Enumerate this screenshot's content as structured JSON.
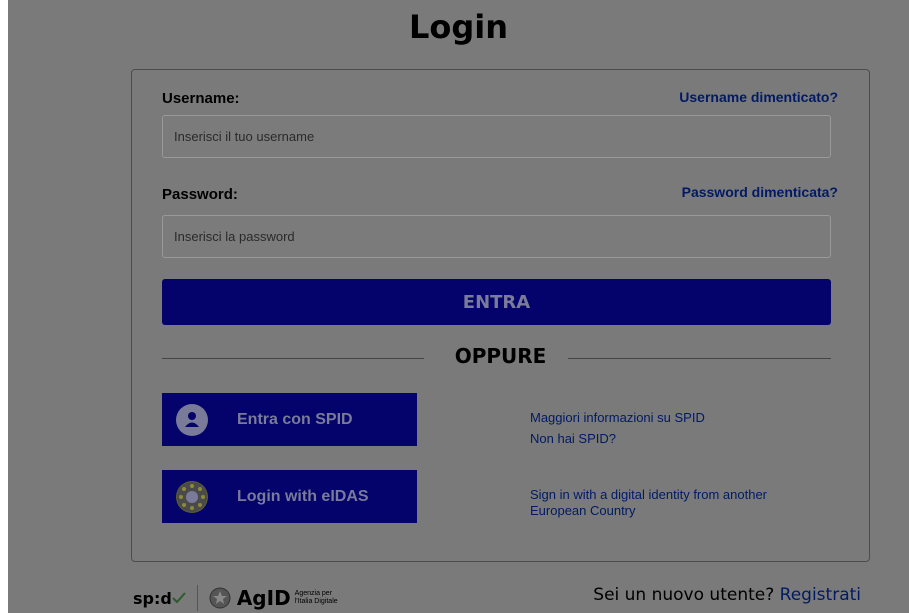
{
  "page": {
    "title": "Login"
  },
  "form": {
    "username_label": "Username:",
    "username_forgot": "Username dimenticato?",
    "username_placeholder": "Inserisci il tuo username",
    "password_label": "Password:",
    "password_forgot": "Password dimenticata?",
    "password_placeholder": "Inserisci la password",
    "submit_label": "ENTRA",
    "separator_label": "OPPURE"
  },
  "identity": {
    "spid_button_label": "Entra con SPID",
    "spid_info_link": "Maggiori informazioni su SPID",
    "spid_missing_link": "Non hai SPID?",
    "eidas_button_label": "Login with eIDAS",
    "eidas_info_line1": "Sign in with a digital identity from another",
    "eidas_info_line2": "European Country"
  },
  "footer": {
    "spid_logo_text": "sp:d",
    "agid_logo_text": "AgID",
    "agid_sub_line1": "Agenzia per",
    "agid_sub_line2": "l'Italia Digitale",
    "new_user_text": "Sei un nuovo utente?",
    "register_link": "Registrati"
  },
  "colors": {
    "primary_button": "#03036b",
    "link": "#001a66",
    "overlay_background": "#7a7a7a"
  }
}
